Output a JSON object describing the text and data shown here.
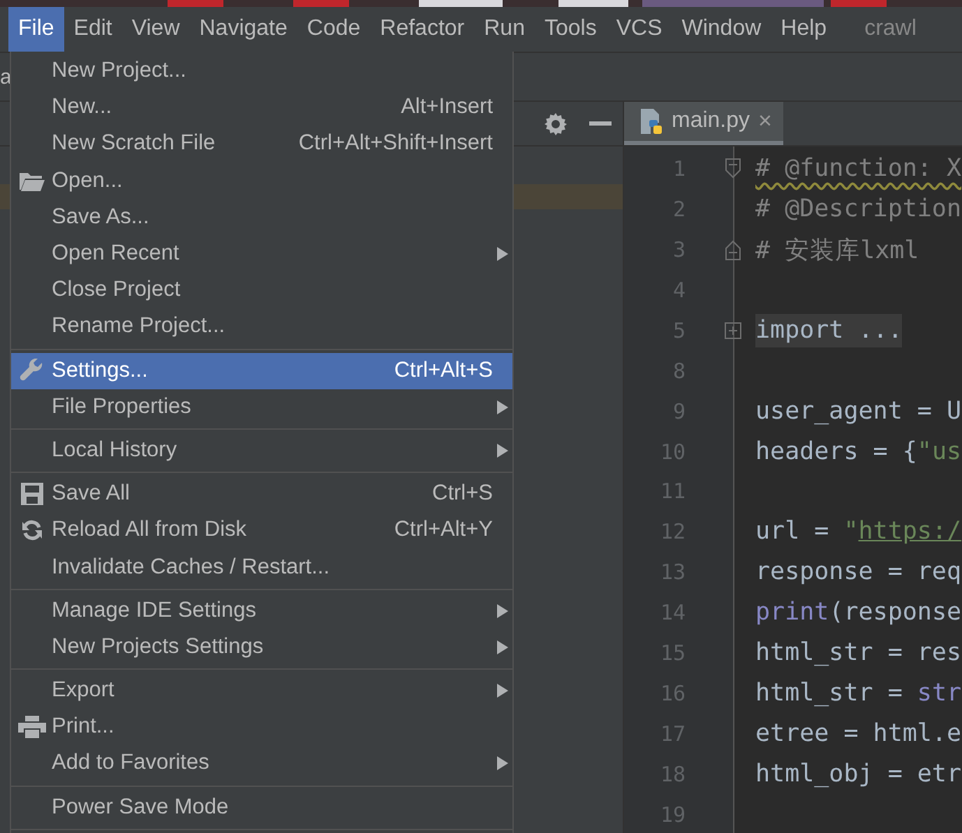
{
  "menubar": {
    "items": [
      {
        "label": "File",
        "selected": true
      },
      {
        "label": "Edit",
        "selected": false
      },
      {
        "label": "View",
        "selected": false
      },
      {
        "label": "Navigate",
        "selected": false
      },
      {
        "label": "Code",
        "selected": false
      },
      {
        "label": "Refactor",
        "selected": false
      },
      {
        "label": "Run",
        "selected": false
      },
      {
        "label": "Tools",
        "selected": false
      },
      {
        "label": "VCS",
        "selected": false
      },
      {
        "label": "Window",
        "selected": false
      },
      {
        "label": "Help",
        "selected": false
      }
    ],
    "project_title": "crawl"
  },
  "navbar_text": "a",
  "file_menu": [
    {
      "kind": "item",
      "label": "New Project...",
      "submenu": false,
      "selected": false
    },
    {
      "kind": "item",
      "label": "New...",
      "shortcut": "Alt+Insert",
      "submenu": false,
      "selected": false
    },
    {
      "kind": "item",
      "label": "New Scratch File",
      "shortcut": "Ctrl+Alt+Shift+Insert",
      "submenu": false,
      "selected": false
    },
    {
      "kind": "item",
      "label": "Open...",
      "submenu": false,
      "selected": false
    },
    {
      "kind": "item",
      "label": "Save As...",
      "submenu": false,
      "selected": false
    },
    {
      "kind": "item",
      "label": "Open Recent",
      "submenu": true,
      "selected": false
    },
    {
      "kind": "item",
      "label": "Close Project",
      "submenu": false,
      "selected": false
    },
    {
      "kind": "item",
      "label": "Rename Project...",
      "submenu": false,
      "selected": false
    },
    {
      "kind": "separator"
    },
    {
      "kind": "item",
      "label": "Settings...",
      "shortcut": "Ctrl+Alt+S",
      "submenu": false,
      "selected": true
    },
    {
      "kind": "item",
      "label": "File Properties",
      "submenu": true,
      "selected": false
    },
    {
      "kind": "separator"
    },
    {
      "kind": "item",
      "label": "Local History",
      "submenu": true,
      "selected": false
    },
    {
      "kind": "separator"
    },
    {
      "kind": "item",
      "label": "Save All",
      "shortcut": "Ctrl+S",
      "submenu": false,
      "selected": false
    },
    {
      "kind": "item",
      "label": "Reload All from Disk",
      "shortcut": "Ctrl+Alt+Y",
      "submenu": false,
      "selected": false
    },
    {
      "kind": "item",
      "label": "Invalidate Caches / Restart...",
      "submenu": false,
      "selected": false
    },
    {
      "kind": "separator"
    },
    {
      "kind": "item",
      "label": "Manage IDE Settings",
      "submenu": true,
      "selected": false
    },
    {
      "kind": "item",
      "label": "New Projects Settings",
      "submenu": true,
      "selected": false
    },
    {
      "kind": "separator"
    },
    {
      "kind": "item",
      "label": "Export",
      "submenu": true,
      "selected": false
    },
    {
      "kind": "item",
      "label": "Print...",
      "submenu": false,
      "selected": false
    },
    {
      "kind": "item",
      "label": "Add to Favorites",
      "submenu": true,
      "selected": false
    },
    {
      "kind": "separator"
    },
    {
      "kind": "item",
      "label": "Power Save Mode",
      "submenu": false,
      "selected": false
    },
    {
      "kind": "separator"
    }
  ],
  "editor": {
    "tabs": [
      {
        "label": "main.py",
        "close": "×",
        "selected": true
      }
    ],
    "lines": [
      {
        "number": "1",
        "warning": true,
        "tokens": [
          {
            "text": "# @function: X",
            "kind": "comment"
          }
        ]
      },
      {
        "number": "2",
        "tokens": [
          {
            "text": "# @Description",
            "kind": "comment"
          }
        ]
      },
      {
        "number": "3",
        "tokens": [
          {
            "text": "# 安装库lxml",
            "kind": "comment"
          }
        ]
      },
      {
        "number": "4"
      },
      {
        "number": "5",
        "tokens": [
          {
            "text": "import ...",
            "kind": "folded"
          }
        ]
      },
      {
        "number": "8"
      },
      {
        "number": "9",
        "tokens": [
          {
            "text": "user_agent = U",
            "kind": "plain"
          }
        ]
      },
      {
        "number": "10",
        "tokens": [
          {
            "text": "headers = {",
            "kind": "plain"
          },
          {
            "text": "\"us",
            "kind": "string"
          }
        ]
      },
      {
        "number": "11"
      },
      {
        "number": "12",
        "tokens": [
          {
            "text": "url = ",
            "kind": "plain"
          },
          {
            "text": "\"",
            "kind": "string"
          },
          {
            "text": "https:/",
            "kind": "link"
          }
        ]
      },
      {
        "number": "13",
        "tokens": [
          {
            "text": "response = req",
            "kind": "plain"
          }
        ]
      },
      {
        "number": "14",
        "tokens": [
          {
            "text": "print",
            "kind": "builtin"
          },
          {
            "text": "(response",
            "kind": "plain"
          }
        ]
      },
      {
        "number": "15",
        "tokens": [
          {
            "text": "html_str = res",
            "kind": "plain"
          }
        ]
      },
      {
        "number": "16",
        "tokens": [
          {
            "text": "html_str = ",
            "kind": "plain"
          },
          {
            "text": "str",
            "kind": "builtin"
          }
        ]
      },
      {
        "number": "17",
        "tokens": [
          {
            "text": "etree = html.e",
            "kind": "plain"
          }
        ]
      },
      {
        "number": "18",
        "tokens": [
          {
            "text": "html_obj = etr",
            "kind": "plain"
          }
        ]
      },
      {
        "number": "19"
      }
    ]
  }
}
